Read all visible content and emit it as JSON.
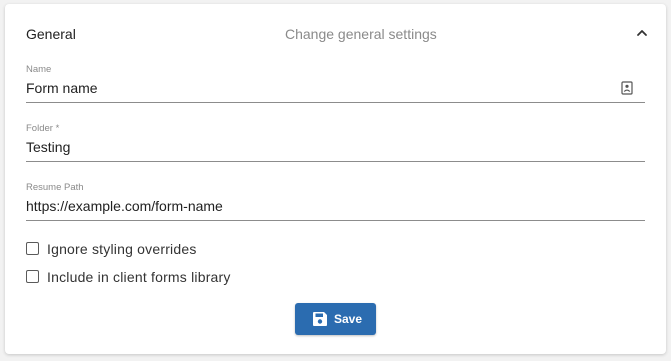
{
  "section": {
    "title": "General",
    "subtitle": "Change general settings",
    "collapse_icon": "chevron-up-icon"
  },
  "fields": [
    {
      "label": "Name",
      "value": "Form name",
      "icon": "contact-card-icon"
    },
    {
      "label": "Folder *",
      "value": "Testing"
    },
    {
      "label": "Resume Path",
      "value": "https://example.com/form-name"
    }
  ],
  "checkboxes": [
    {
      "label": "Ignore styling overrides",
      "checked": false
    },
    {
      "label": "Include in client forms library",
      "checked": false
    }
  ],
  "save_button": {
    "label": "Save",
    "icon": "floppy-disk-icon",
    "color": "#2b6cb0"
  }
}
